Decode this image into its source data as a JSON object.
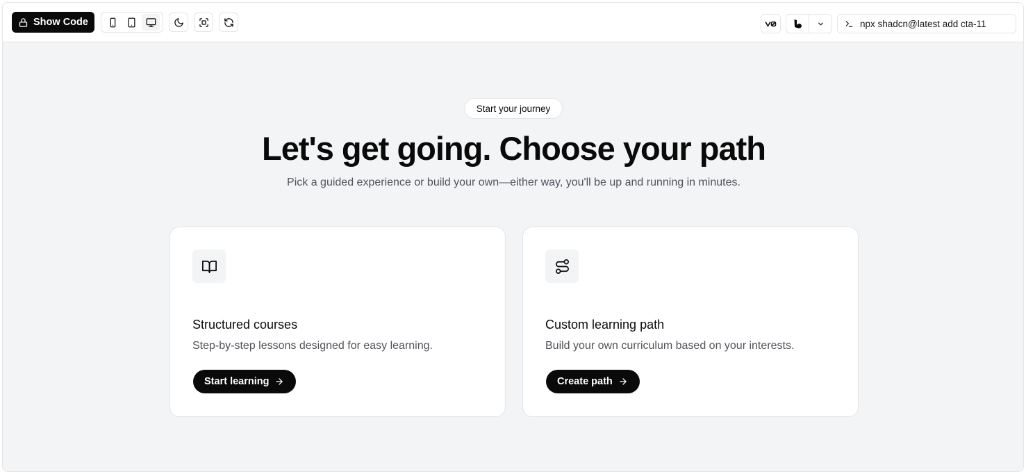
{
  "toolbar": {
    "show_code_label": "Show Code",
    "devices": [
      "mobile",
      "tablet",
      "desktop"
    ],
    "active_device": "desktop",
    "cli_command": "npx shadcn@latest add cta-11",
    "v0_label": "v0"
  },
  "hero": {
    "badge": "Start your journey",
    "title": "Let's get going. Choose your path",
    "subtitle": "Pick a guided experience or build your own—either way, you'll be up and running in minutes."
  },
  "cards": [
    {
      "icon": "book-open-icon",
      "title": "Structured courses",
      "description": "Step-by-step lessons designed for easy learning.",
      "button_label": "Start learning"
    },
    {
      "icon": "route-icon",
      "title": "Custom learning path",
      "description": "Build your own curriculum based on your interests.",
      "button_label": "Create path"
    }
  ],
  "colors": {
    "primary": "#0a0a0a",
    "background": "#f3f4f6",
    "muted_text": "#52525b",
    "border": "#e4e4e7"
  }
}
